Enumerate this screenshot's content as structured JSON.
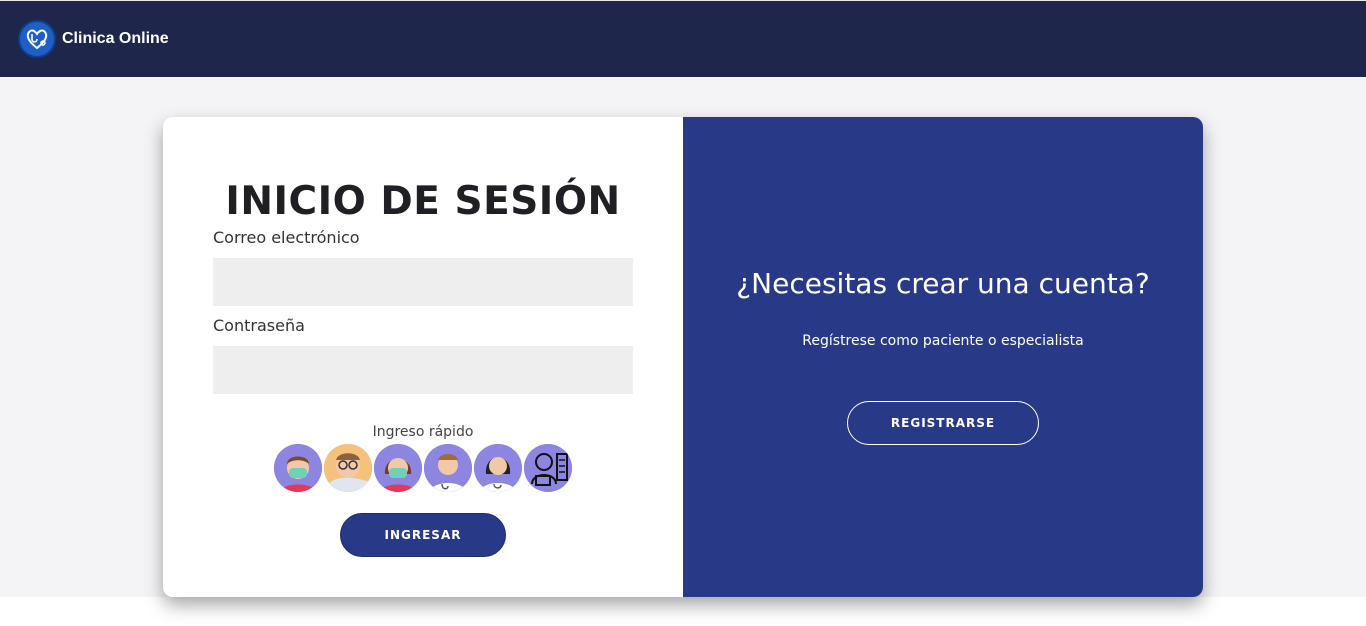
{
  "navbar": {
    "brand_name": "Clinica Online",
    "logo_icon": "heart-stethoscope-icon",
    "background": "#1e274b"
  },
  "login": {
    "title": "INICIO DE SESIÓN",
    "email_label": "Correo electrónico",
    "email_value": "",
    "email_placeholder": "",
    "password_label": "Contraseña",
    "password_value": "",
    "password_placeholder": "",
    "quick_access_label": "Ingreso rápido",
    "quick_users": [
      {
        "icon": "masked-man-avatar-icon"
      },
      {
        "icon": "man-with-glasses-avatar-icon"
      },
      {
        "icon": "masked-woman-avatar-icon"
      },
      {
        "icon": "male-doctor-avatar-icon"
      },
      {
        "icon": "female-doctor-avatar-icon"
      },
      {
        "icon": "admin-avatar-icon"
      }
    ],
    "submit_label": "INGRESAR"
  },
  "register": {
    "title": "¿Necesitas crear una cuenta?",
    "subtitle": "Regístrese como paciente o especialista",
    "button_label": "REGISTRARSE",
    "background": "#283a87"
  }
}
